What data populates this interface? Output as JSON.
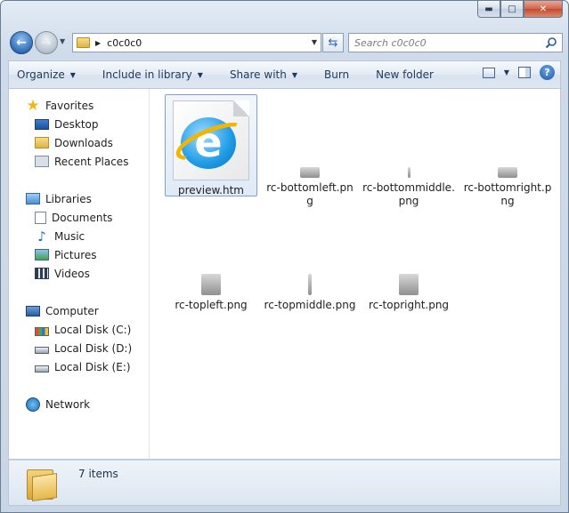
{
  "window": {
    "caption": {
      "minimize": "▬",
      "maximize": "□",
      "close": "✕"
    }
  },
  "address": {
    "path": "c0c0c0",
    "search_placeholder": "Search c0c0c0"
  },
  "toolbar": {
    "organize": "Organize",
    "include": "Include in library",
    "share": "Share with",
    "burn": "Burn",
    "new_folder": "New folder"
  },
  "nav": {
    "favorites": {
      "label": "Favorites",
      "items": [
        "Desktop",
        "Downloads",
        "Recent Places"
      ]
    },
    "libraries": {
      "label": "Libraries",
      "items": [
        "Documents",
        "Music",
        "Pictures",
        "Videos"
      ]
    },
    "computer": {
      "label": "Computer",
      "items": [
        "Local Disk (C:)",
        "Local Disk (D:)",
        "Local Disk (E:)"
      ]
    },
    "network": {
      "label": "Network"
    }
  },
  "files": [
    {
      "name": "preview.htm",
      "icon": "internet-explorer-icon",
      "selected": true
    },
    {
      "name": "rc-bottomleft.png",
      "icon": "png-thumbnail"
    },
    {
      "name": "rc-bottommiddle.png",
      "icon": "png-thumbnail"
    },
    {
      "name": "rc-bottomright.png",
      "icon": "png-thumbnail"
    },
    {
      "name": "rc-topleft.png",
      "icon": "png-thumbnail"
    },
    {
      "name": "rc-topmiddle.png",
      "icon": "png-thumbnail"
    },
    {
      "name": "rc-topright.png",
      "icon": "png-thumbnail"
    }
  ],
  "status": {
    "count": "7 items"
  },
  "colors": {
    "selection_border": "#7da2ce",
    "toolbar_text": "#1e395b",
    "window_frame": "#c9d6e6"
  }
}
